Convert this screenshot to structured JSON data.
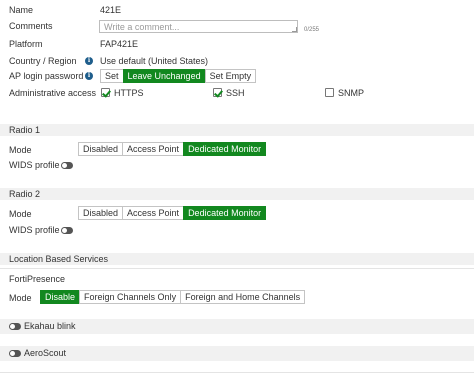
{
  "general": {
    "name_label": "Name",
    "name_value": "421E",
    "comments_label": "Comments",
    "comments_placeholder": "Write a comment...",
    "comments_counter": "0/255",
    "platform_label": "Platform",
    "platform_value": "FAP421E",
    "country_label": "Country / Region",
    "country_value": "Use default (United States)",
    "ap_login_label": "AP login password",
    "ap_login_options": [
      "Set",
      "Leave Unchanged",
      "Set Empty"
    ],
    "ap_login_selected": "Leave Unchanged",
    "admin_access_label": "Administrative access",
    "admin_access": [
      {
        "label": "HTTPS",
        "checked": true
      },
      {
        "label": "SSH",
        "checked": true
      },
      {
        "label": "SNMP",
        "checked": false
      }
    ]
  },
  "radio1": {
    "title": "Radio 1",
    "mode_label": "Mode",
    "mode_options": [
      "Disabled",
      "Access Point",
      "Dedicated Monitor"
    ],
    "mode_selected": "Dedicated Monitor",
    "wids_label": "WIDS profile",
    "wids_enabled": false
  },
  "radio2": {
    "title": "Radio 2",
    "mode_label": "Mode",
    "mode_options": [
      "Disabled",
      "Access Point",
      "Dedicated Monitor"
    ],
    "mode_selected": "Dedicated Monitor",
    "wids_label": "WIDS profile",
    "wids_enabled": false
  },
  "lbs": {
    "title": "Location Based Services",
    "fortipresence_title": "FortiPresence",
    "mode_label": "Mode",
    "mode_options": [
      "Disable",
      "Foreign Channels Only",
      "Foreign and Home Channels"
    ],
    "mode_selected": "Disable",
    "ekahau_label": "Ekahau blink",
    "ekahau_enabled": false,
    "aeroscout_label": "AeroScout",
    "aeroscout_enabled": false
  },
  "colors": {
    "accent": "#12881f",
    "section_bg": "#f1f1f1",
    "info_icon": "#1f5e8c"
  }
}
